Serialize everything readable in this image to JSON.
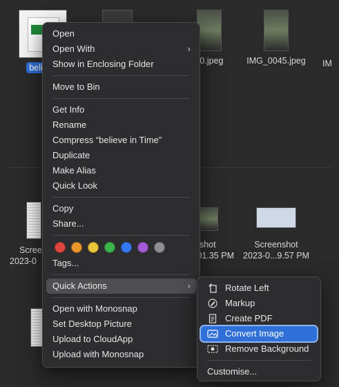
{
  "finder": {
    "files_row1": [
      {
        "label": "believe",
        "selected": true
      },
      {
        "label": ""
      },
      {
        "label": "40.jpeg"
      },
      {
        "label": "IMG_0045.jpeg"
      },
      {
        "label": "IM"
      }
    ],
    "files_row2": [
      {
        "line1": "Scree",
        "line2": "2023-0"
      },
      {
        "line1": "nshot",
        "line2": ".01.35 PM"
      },
      {
        "line1": "Screenshot",
        "line2": "2023-0...9.57 PM"
      }
    ]
  },
  "context_menu": {
    "items_group1": [
      "Open",
      "Open With",
      "Show in Enclosing Folder"
    ],
    "items_group2": [
      "Move to Bin"
    ],
    "items_group3": [
      "Get Info",
      "Rename",
      "Compress “believe in Time”",
      "Duplicate",
      "Make Alias",
      "Quick Look"
    ],
    "items_group4": [
      "Copy",
      "Share..."
    ],
    "tag_colors": [
      "#e0463f",
      "#e9962c",
      "#eac43a",
      "#3cb34a",
      "#3478f6",
      "#a55ad8",
      "#8e8e93"
    ],
    "tags_label": "Tags...",
    "quick_actions_label": "Quick Actions",
    "items_group5": [
      "Open with Monosnap",
      "Set Desktop Picture",
      "Upload to CloudApp",
      "Upload with Monosnap"
    ],
    "chevron": "›"
  },
  "submenu": {
    "items": [
      {
        "label": "Rotate Left",
        "icon": "rotate-left-icon"
      },
      {
        "label": "Markup",
        "icon": "markup-icon"
      },
      {
        "label": "Create PDF",
        "icon": "pdf-icon"
      },
      {
        "label": "Convert Image",
        "icon": "convert-image-icon"
      },
      {
        "label": "Remove Background",
        "icon": "remove-background-icon"
      }
    ],
    "customise_label": "Customise..."
  }
}
